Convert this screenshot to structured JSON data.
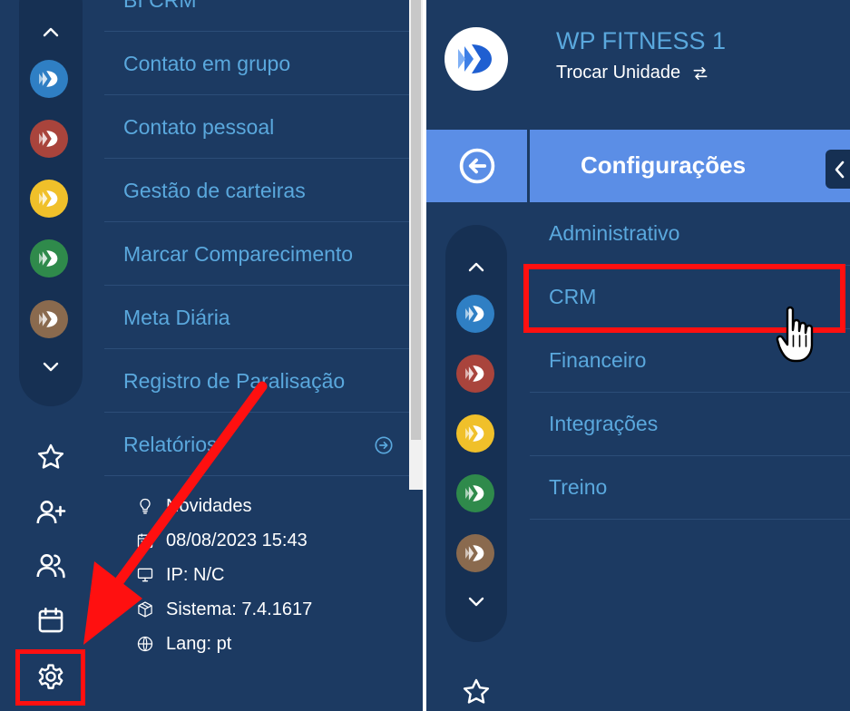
{
  "left": {
    "units": [
      {
        "name": "unit-1",
        "color": "#2f7fc4"
      },
      {
        "name": "unit-2",
        "color": "#a9443c"
      },
      {
        "name": "unit-3",
        "color": "#f0c02a"
      },
      {
        "name": "unit-4",
        "color": "#2f8a4b"
      },
      {
        "name": "unit-5",
        "color": "#8a6a4e"
      }
    ],
    "menu_items": [
      {
        "label": "BI CRM"
      },
      {
        "label": "Contato em grupo"
      },
      {
        "label": "Contato pessoal"
      },
      {
        "label": "Gestão de carteiras"
      },
      {
        "label": "Marcar Comparecimento"
      },
      {
        "label": "Meta Diária"
      },
      {
        "label": "Registro de Paralisação"
      },
      {
        "label": "Relatórios"
      }
    ],
    "footer": {
      "news": "Novidades",
      "datetime": "08/08/2023  15:43",
      "ip": "IP: N/C",
      "system": "Sistema: 7.4.1617",
      "lang": "Lang: pt"
    },
    "rail_icons": [
      "star-icon",
      "add-user-icon",
      "users-icon",
      "calendar-icon",
      "gear-icon"
    ]
  },
  "right": {
    "unit_name": "WP FITNESS 1",
    "switch_unit": "Trocar Unidade",
    "section_title": "Configurações",
    "menu_items": [
      {
        "label": "Administrativo"
      },
      {
        "label": "CRM"
      },
      {
        "label": "Financeiro"
      },
      {
        "label": "Integrações"
      },
      {
        "label": "Treino"
      }
    ]
  },
  "colors": {
    "background": "#1c3a62",
    "accent_text": "#5aa8dd",
    "header_blue": "#5b8ee6",
    "highlight_red": "#ff1010"
  }
}
